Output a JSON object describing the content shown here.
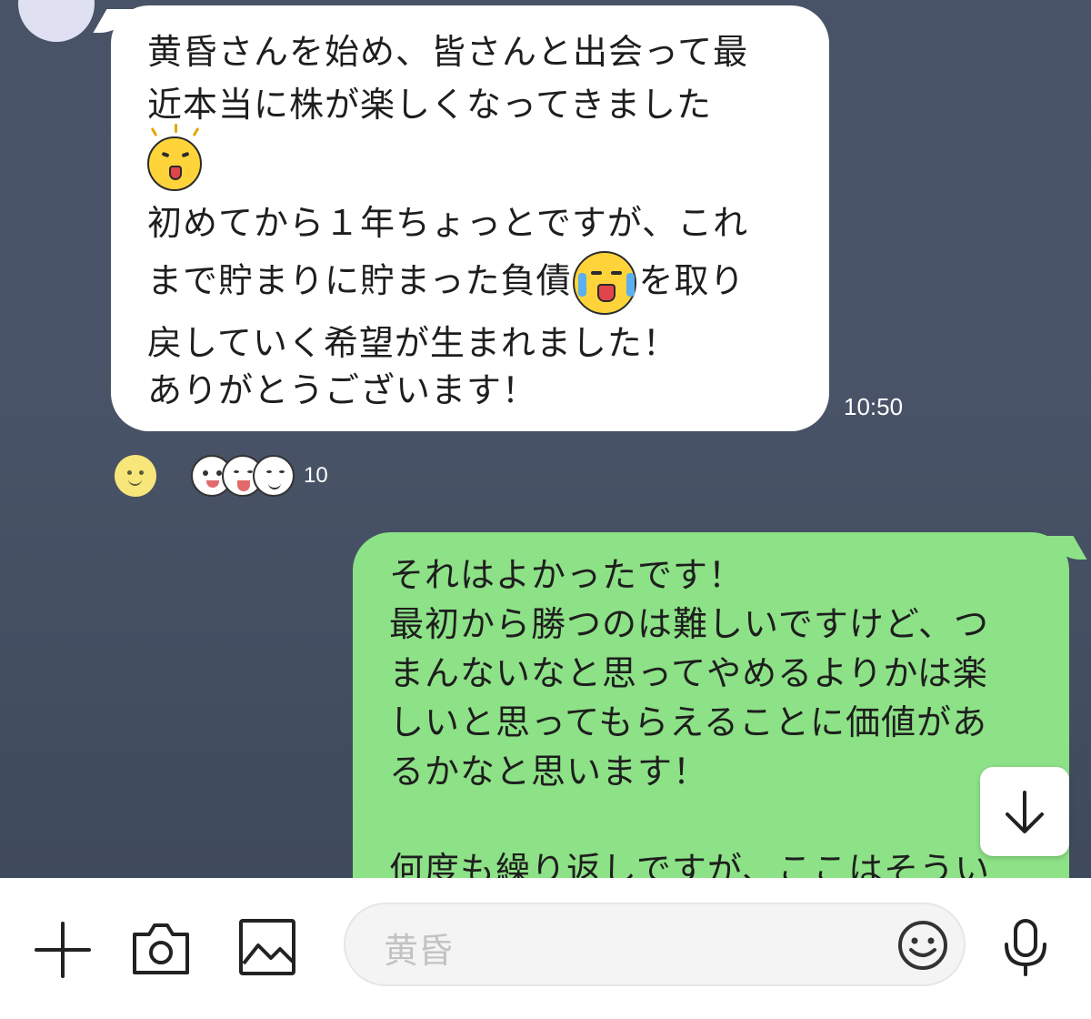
{
  "incoming_message": {
    "lines": [
      "黄昏さんを始め、皆さんと出会って最",
      "近本当に株が楽しくなってきました",
      "初めてから１年ちょっとですが、これ",
      "まで貯まりに貯まった負債",
      "を取り",
      "戻していく希望が生まれました！",
      "ありがとうございます！"
    ],
    "emoji_1": "excited-face-emoji",
    "emoji_2": "crying-laughing-face-emoji",
    "time": "10:50"
  },
  "reactions": {
    "add_icon": "smiley-reaction-icon",
    "faces": [
      "blushing-face",
      "laughing-face",
      "smiling-face"
    ],
    "count": "10"
  },
  "outgoing_message": {
    "lines": [
      "それはよかったです！",
      "最初から勝つのは難しいですけど、つ",
      "まんないなと思ってやめるよりかは楽",
      "しいと思ってもらえることに価値があ",
      "るかなと思います！",
      "",
      "何度も繰り返しですが、ここはそうい"
    ]
  },
  "input_bar": {
    "placeholder": "黄昏",
    "icons": [
      "plus-icon",
      "camera-icon",
      "image-icon",
      "emoji-icon",
      "microphone-icon"
    ]
  },
  "colors": {
    "chat_background": "#4a5468",
    "incoming_bubble": "#ffffff",
    "outgoing_bubble": "#8de186"
  }
}
